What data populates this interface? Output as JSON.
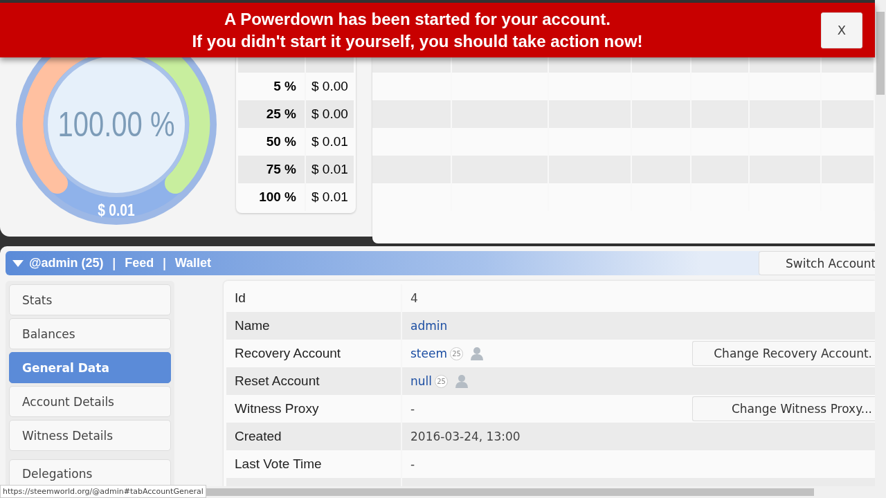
{
  "alert": {
    "lines": [
      "A Powerdown has been started for your account.",
      "If you didn't start it yourself, you should take action now!"
    ],
    "close": "X"
  },
  "gauge": {
    "percent": "100.00 %",
    "value": "$ 0.01"
  },
  "vote_table": {
    "rows": [
      {
        "percent": "5 %",
        "value": "$ 0.00"
      },
      {
        "percent": "25 %",
        "value": "$ 0.00"
      },
      {
        "percent": "50 %",
        "value": "$ 0.01"
      },
      {
        "percent": "75 %",
        "value": "$ 0.01"
      },
      {
        "percent": "100 %",
        "value": "$ 0.01"
      }
    ]
  },
  "account_bar": {
    "links": [
      "@admin (25)",
      "Feed",
      "Wallet"
    ],
    "separator": "|",
    "expanded": true,
    "switch_button": "Switch Account"
  },
  "sidebar": {
    "items": [
      {
        "label": "Stats",
        "selected": false
      },
      {
        "label": "Balances",
        "selected": false
      },
      {
        "label": "General Data",
        "selected": true
      },
      {
        "label": "Account Details",
        "selected": false
      },
      {
        "label": "Witness Details",
        "selected": false
      },
      {
        "label": "Delegations",
        "selected": false
      }
    ]
  },
  "general_table": {
    "rows": [
      {
        "label": "Id",
        "value": "4",
        "kind": "text"
      },
      {
        "label": "Name",
        "value": "admin",
        "kind": "link"
      },
      {
        "label": "Recovery Account",
        "value": "steem",
        "kind": "account",
        "badge": "25",
        "button": "Change Recovery Account."
      },
      {
        "label": "Reset Account",
        "value": "null",
        "kind": "account",
        "badge": "25"
      },
      {
        "label": "Witness Proxy",
        "value": "-",
        "kind": "text",
        "button": "Change Witness Proxy..."
      },
      {
        "label": "Created",
        "value": "2016-03-24, 13:00",
        "kind": "text"
      },
      {
        "label": "Last Vote Time",
        "value": "-",
        "kind": "text"
      }
    ]
  },
  "status_url": "https://steemworld.org/@admin#tabAccountGeneral"
}
